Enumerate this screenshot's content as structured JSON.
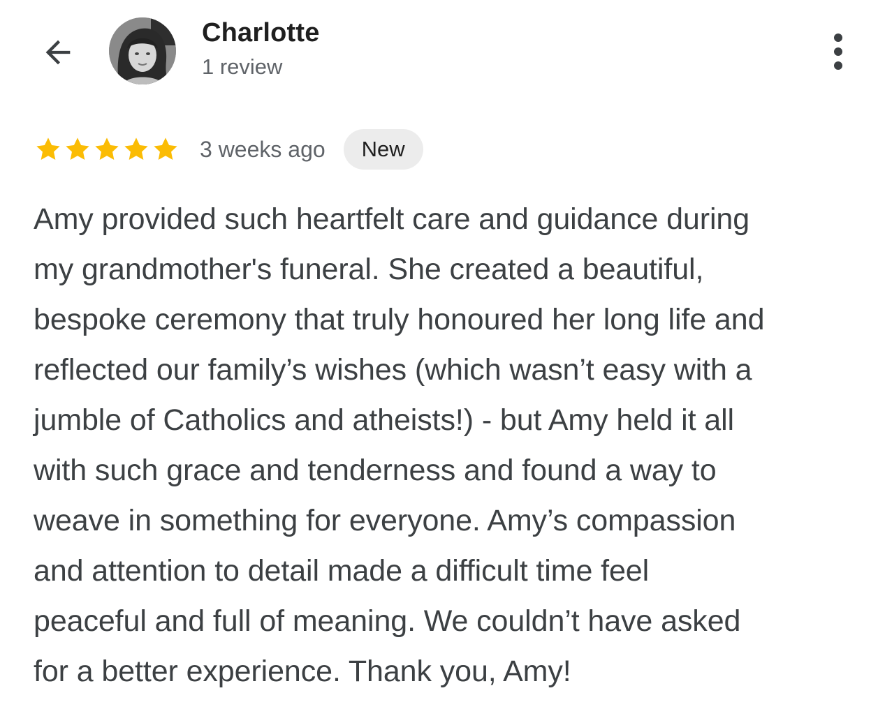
{
  "header": {
    "back_icon": "arrow-back-icon",
    "reviewer_name": "Charlotte",
    "review_count": "1 review",
    "more_icon": "more-vert-icon"
  },
  "review": {
    "rating": 5,
    "rating_max": 5,
    "star_color": "#fbbc04",
    "time_ago": "3 weeks ago",
    "badge": "New",
    "text_lines": [
      "Amy provided such heartfelt care and guidance during",
      "my grandmother's funeral. She created a beautiful,",
      "bespoke ceremony that truly honoured her long life and",
      "reflected our family’s wishes (which wasn’t easy with a",
      "jumble of Catholics and atheists!) - but Amy held it all",
      "with such grace and tenderness and found a way to",
      "weave in something for everyone. Amy’s compassion",
      "and attention to detail made a difficult time feel",
      "peaceful and full of meaning. We couldn’t have asked",
      "for a better experience. Thank you, Amy!"
    ]
  }
}
